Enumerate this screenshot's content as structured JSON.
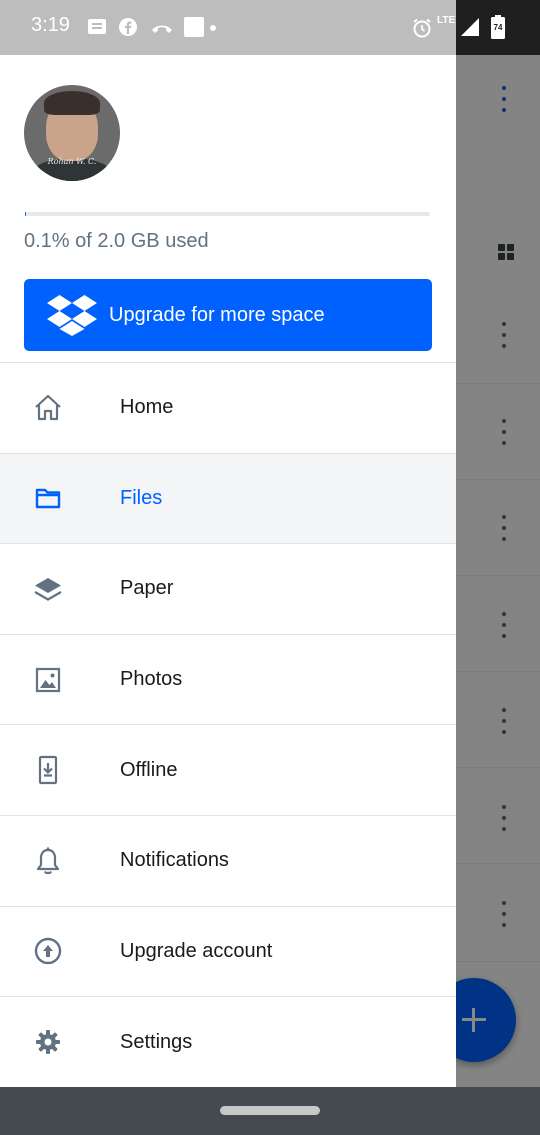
{
  "status_bar": {
    "time": "3:19",
    "network_label": "LTE",
    "battery_level": "74",
    "icons": [
      "message-icon",
      "facebook-icon",
      "missed-call-icon",
      "square-icon",
      "dot-icon",
      "alarm-icon",
      "signal-icon",
      "battery-icon"
    ]
  },
  "profile": {
    "avatar_signature": "Rohan W. C."
  },
  "storage": {
    "used_fraction": 0.001,
    "text": "0.1% of 2.0 GB used"
  },
  "upgrade_button": {
    "label": "Upgrade for more space",
    "icon": "dropbox-logo-icon"
  },
  "nav": {
    "items": [
      {
        "label": "Home",
        "icon": "home-icon",
        "active": false
      },
      {
        "label": "Files",
        "icon": "folder-icon",
        "active": true
      },
      {
        "label": "Paper",
        "icon": "paper-layers-icon",
        "active": false
      },
      {
        "label": "Photos",
        "icon": "photo-icon",
        "active": false
      },
      {
        "label": "Offline",
        "icon": "offline-download-icon",
        "active": false
      },
      {
        "label": "Notifications",
        "icon": "bell-icon",
        "active": false
      },
      {
        "label": "Upgrade account",
        "icon": "upgrade-arrow-icon",
        "active": false
      },
      {
        "label": "Settings",
        "icon": "gear-icon",
        "active": false
      }
    ]
  },
  "colors": {
    "brand_blue": "#0061fe",
    "active_bg": "#f4f5f7",
    "text_primary": "#1e1919",
    "text_secondary": "#637282",
    "icon_gray": "#637282"
  }
}
